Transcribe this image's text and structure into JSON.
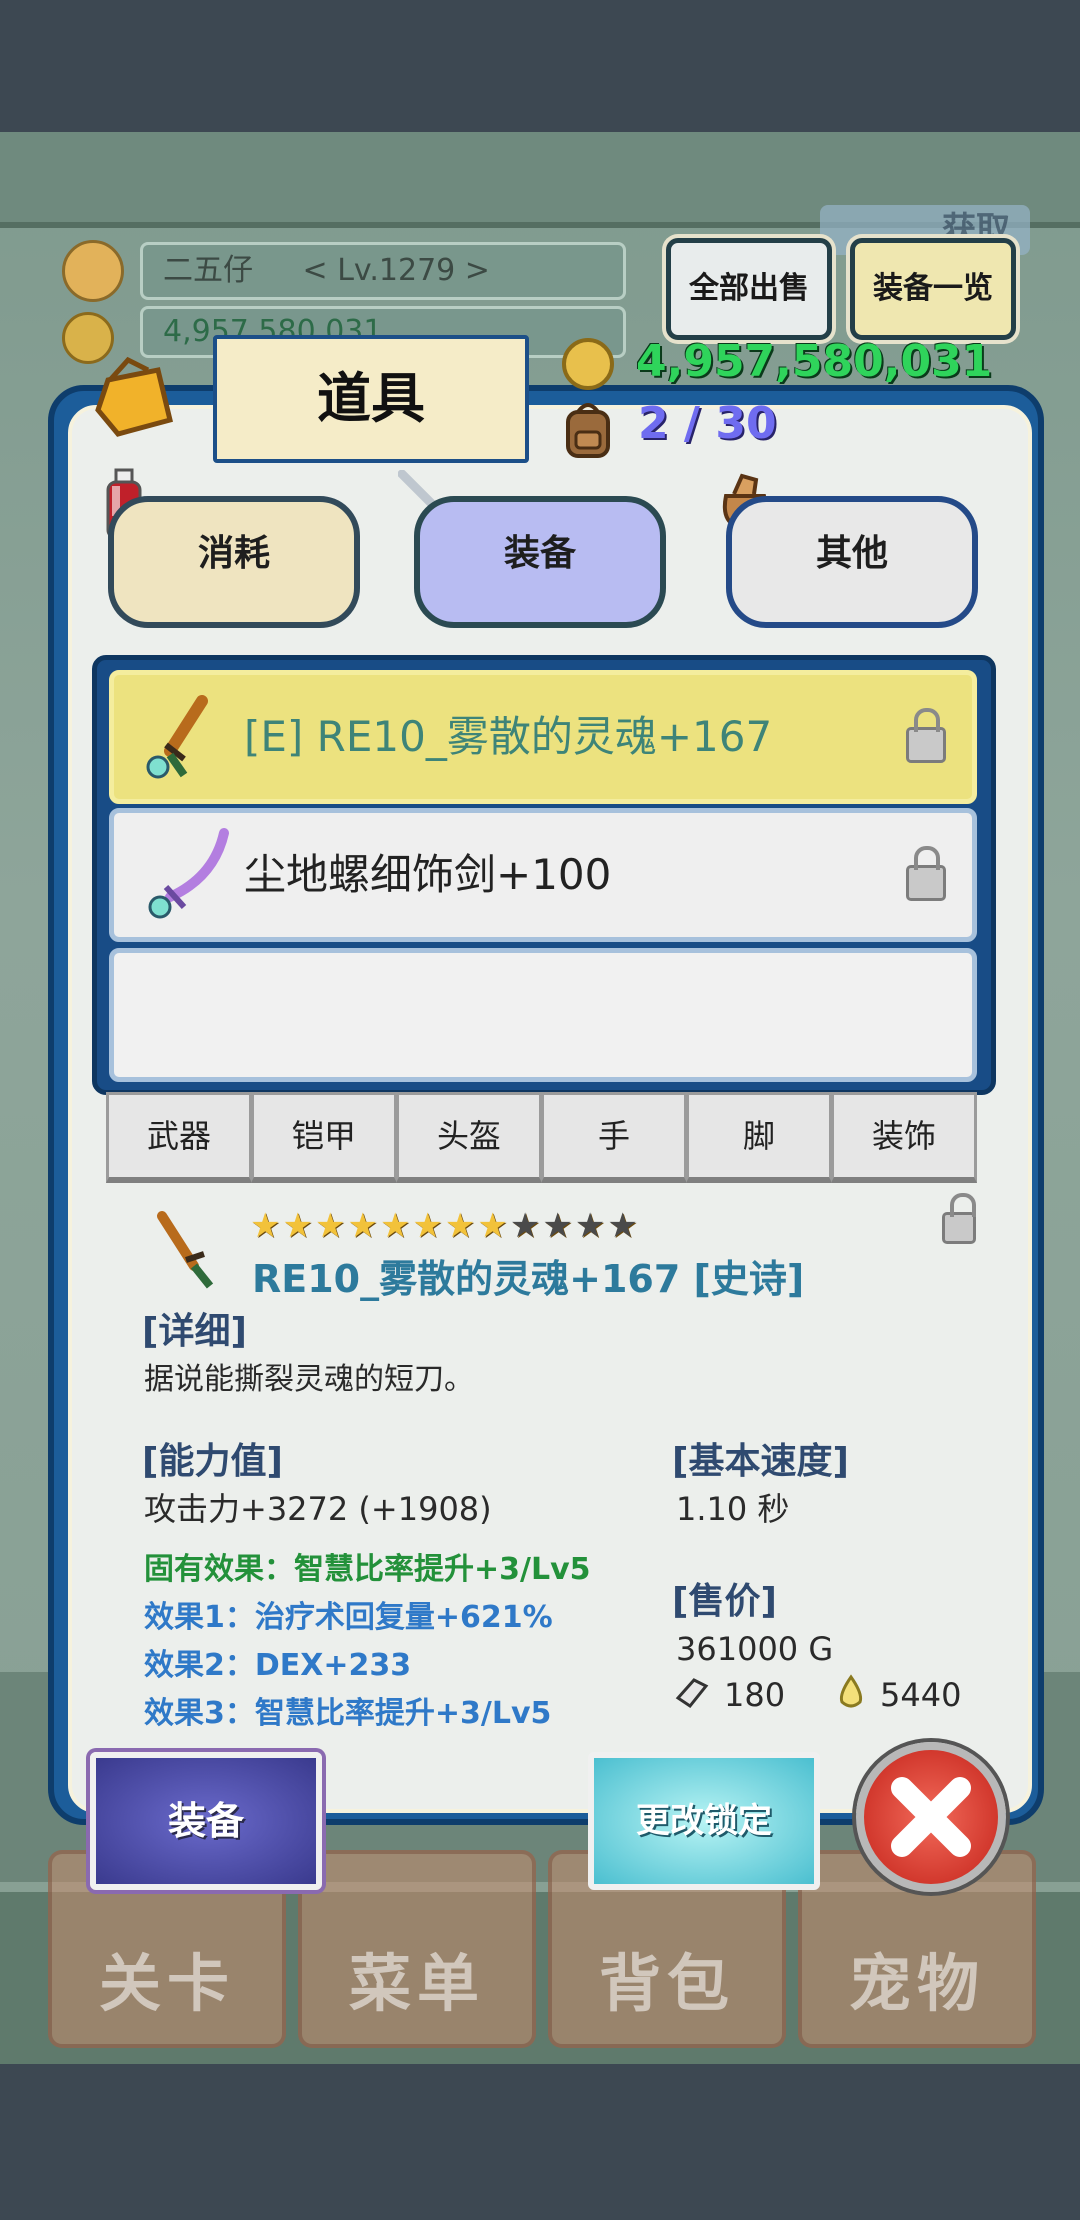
{
  "background": {
    "bottom_tabs": [
      "关卡",
      "菜单",
      "背包",
      "宠物"
    ],
    "banner": "获取"
  },
  "player": {
    "name": "二五仔",
    "level": "< Lv.1279 >",
    "gold_partial": "4,957,580,031"
  },
  "header_buttons": {
    "sell_all": "全部出售",
    "equip_list": "装备一览"
  },
  "panel": {
    "title": "道具",
    "gold": "4,957,580,031",
    "bag_count": "2 / 30"
  },
  "categories": [
    {
      "label": "消耗",
      "selected": false
    },
    {
      "label": "装备",
      "selected": true
    },
    {
      "label": "其他",
      "selected": false
    }
  ],
  "items": [
    {
      "name": "[E] RE10_雾散的灵魂+167",
      "selected": true,
      "icon": "dagger-icon"
    },
    {
      "name": "尘地螺细饰剑+100",
      "selected": false,
      "icon": "scimitar-icon"
    },
    {
      "name": "",
      "selected": false,
      "icon": ""
    }
  ],
  "sub_tabs": [
    "武器",
    "铠甲",
    "头盔",
    "手",
    "脚",
    "装饰"
  ],
  "detail": {
    "stars_filled": 8,
    "stars_total": 12,
    "name": "RE10_雾散的灵魂+167 [史诗]",
    "detail_header": "[详细]",
    "description": "据说能撕裂灵魂的短刀。",
    "ability_header": "[能力值]",
    "attack": "攻击力+3272 (+1908)",
    "effect_fixed": "固有效果：智慧比率提升+3/Lv5",
    "effect1": "效果1：治疗术回复量+621%",
    "effect2": "效果2：DEX+233",
    "effect3": "效果3：智慧比率提升+3/Lv5",
    "speed_header": "[基本速度]",
    "speed": "1.10 秒",
    "price_header": "[售价]",
    "price": "361000 G",
    "stone": "180",
    "crystal": "5440"
  },
  "actions": {
    "equip": "装备",
    "change_lock": "更改锁定"
  },
  "colors": {
    "panel_blue": "#1c5d9a",
    "selected_row": "#ece27f",
    "gold_text": "#2fd45b",
    "effect_green": "#23913a",
    "effect_blue": "#2f79c8"
  }
}
